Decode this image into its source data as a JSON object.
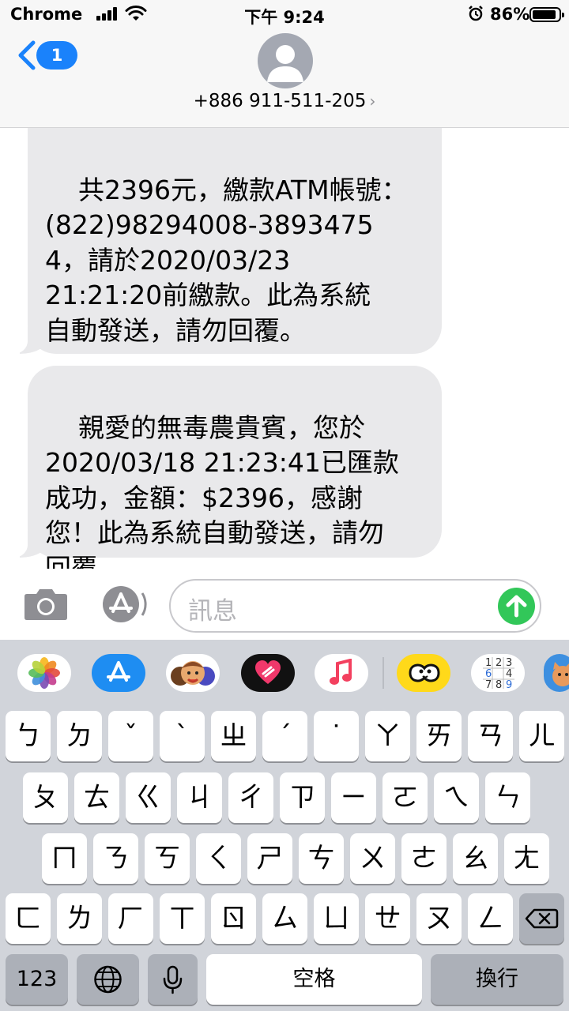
{
  "status_bar": {
    "carrier": "Chrome",
    "time": "下午 9:24",
    "battery": "86%"
  },
  "header": {
    "unread_count": "1",
    "contact": "+886 911-511-205"
  },
  "messages": [
    {
      "id": "bubble1",
      "text": "共2396元，繳款ATM帳號：\n(822)98294008-3893475\n4，請於2020/03/23\n21:21:20前繳款。此為系統\n自動發送，請勿回覆。"
    },
    {
      "id": "bubble2",
      "text": "親愛的無毒農貴賓，您於\n2020/03/18 21:23:41已匯款\n成功，金額：$2396，感謝\n您！此為系統自動發送，請勿\n回覆。"
    }
  ],
  "input": {
    "placeholder": "訊息"
  },
  "app_strip": [
    "photos-icon",
    "app-store-icon",
    "memoji-icon",
    "heart-app-icon",
    "music-icon",
    "peanut-app-icon",
    "sudoku-app-icon",
    "cat-game-icon"
  ],
  "keyboard": {
    "row1": [
      "ㄅ",
      "ㄉ",
      "ˇ",
      "ˋ",
      "ㄓ",
      "ˊ",
      "˙",
      "ㄚ",
      "ㄞ",
      "ㄢ",
      "ㄦ"
    ],
    "row2": [
      "ㄆ",
      "ㄊ",
      "ㄍ",
      "ㄐ",
      "ㄔ",
      "ㄗ",
      "ㄧ",
      "ㄛ",
      "ㄟ",
      "ㄣ"
    ],
    "row3": [
      "ㄇ",
      "ㄋ",
      "ㄎ",
      "ㄑ",
      "ㄕ",
      "ㄘ",
      "ㄨ",
      "ㄜ",
      "ㄠ",
      "ㄤ"
    ],
    "row4": [
      "ㄈ",
      "ㄌ",
      "ㄏ",
      "ㄒ",
      "ㄖ",
      "ㄙ",
      "ㄩ",
      "ㄝ",
      "ㄡ",
      "ㄥ"
    ],
    "numbers_key": "123",
    "space_key": "空格",
    "return_key": "換行"
  },
  "colors": {
    "accent": "#1a82fb",
    "bubble": "#e9e9eb",
    "send": "#32c759",
    "keyboard_bg": "#d1d4da"
  }
}
